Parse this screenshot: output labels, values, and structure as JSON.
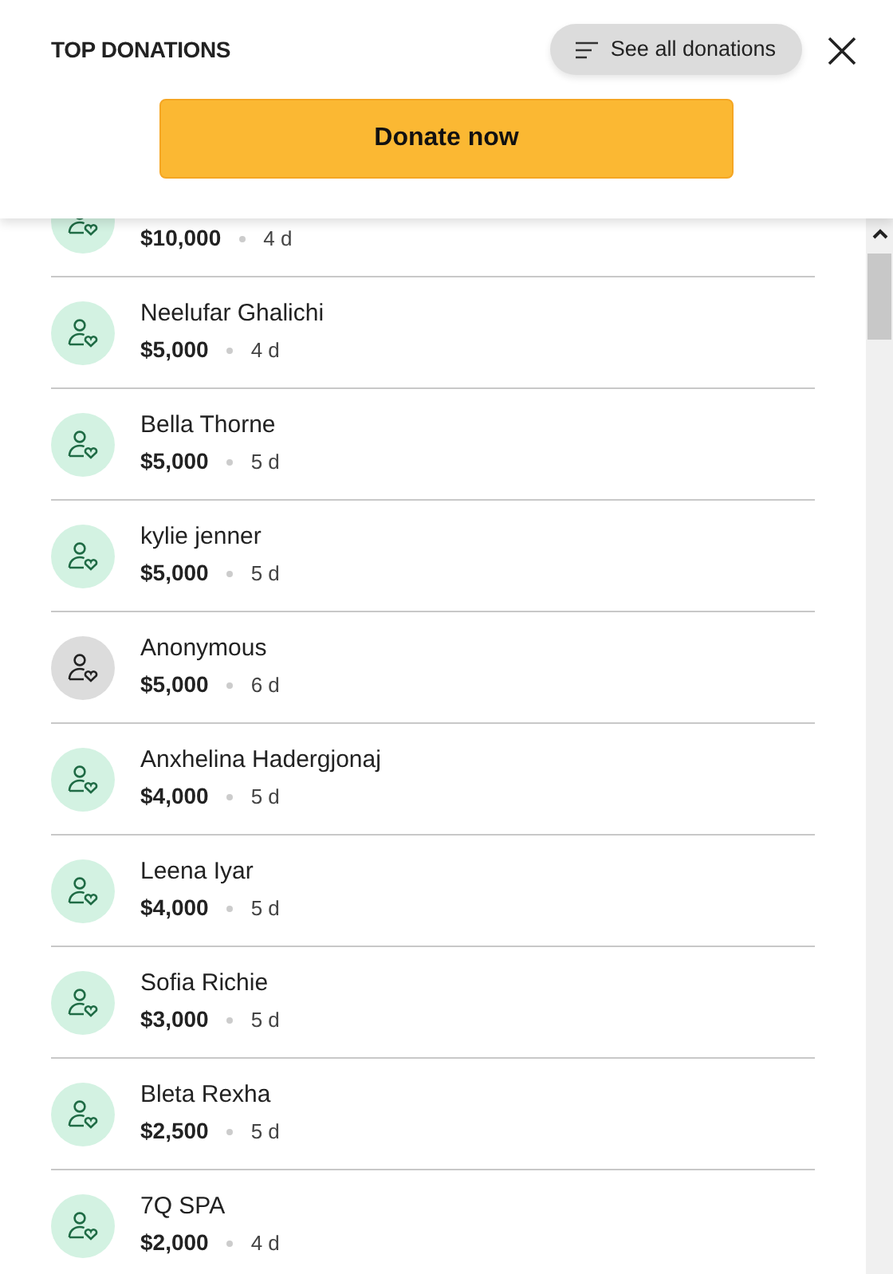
{
  "header": {
    "title": "TOP DONATIONS",
    "see_all": "See all donations",
    "donate": "Donate now"
  },
  "donations": [
    {
      "amount": "$10,000",
      "age": "4 d",
      "color": "#d3f2e2"
    },
    {
      "name": "Neelufar Ghalichi",
      "amount": "$5,000",
      "age": "4 d",
      "color": "#d3f2e2"
    },
    {
      "name": "Bella Thorne",
      "amount": "$5,000",
      "age": "5 d",
      "color": "#d3f2e2"
    },
    {
      "name": "kylie jenner",
      "amount": "$5,000",
      "age": "5 d",
      "color": "#d3f2e2"
    },
    {
      "name": "Anonymous",
      "amount": "$5,000",
      "age": "6 d",
      "color": "#dcdcdc"
    },
    {
      "name": "Anxhelina Hadergjonaj",
      "amount": "$4,000",
      "age": "5 d",
      "color": "#d3f2e2"
    },
    {
      "name": "Leena Iyar",
      "amount": "$4,000",
      "age": "5 d",
      "color": "#d3f2e2"
    },
    {
      "name": "Sofia Richie",
      "amount": "$3,000",
      "age": "5 d",
      "color": "#d3f2e2"
    },
    {
      "name": "Bleta Rexha",
      "amount": "$2,500",
      "age": "5 d",
      "color": "#d3f2e2"
    },
    {
      "name": "7Q SPA",
      "amount": "$2,000",
      "age": "4 d",
      "color": "#d3f2e2"
    }
  ]
}
